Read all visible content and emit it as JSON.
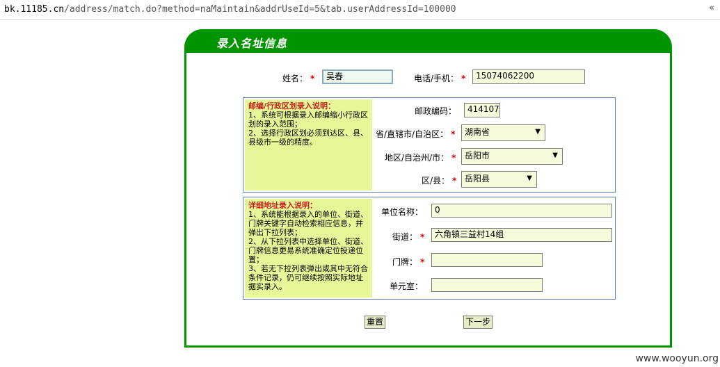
{
  "browser": {
    "url_host": "bk.11185.cn",
    "url_path": "/address/match.do?method=naMaintain&addrUseId=5&tab.userAddressId=100000",
    "menu_chevron": "«"
  },
  "panel": {
    "title": "录入名址信息"
  },
  "required_mark": "*",
  "name": {
    "label": "姓名：",
    "value": "吴春"
  },
  "phone": {
    "label": "电话/手机：",
    "value": "15074062200"
  },
  "region_note": {
    "title": "邮编/行政区划录入说明：",
    "lines": [
      "1、系统可根据录入邮编缩小行政区划的录入范围；",
      "2、选择行政区划必须到达区、县、县级市一级的精度。"
    ]
  },
  "postcode": {
    "label": "邮政编码：",
    "value": "414107"
  },
  "province": {
    "label": "省/直辖市/自治区：",
    "value": "湖南省"
  },
  "city": {
    "label": "地区/自治州/市：",
    "value": "岳阳市"
  },
  "district": {
    "label": "区/县：",
    "value": "岳阳县"
  },
  "detail_note": {
    "title": "详细地址录入说明：",
    "lines": [
      "1、系统能根据录入的单位、街道、门牌关键字自动检索相应信息，并弹出下拉列表；",
      "2、从下拉列表中选择单位、街道、门牌信息更易系统准确定位投递位置；",
      "3、若无下拉列表弹出或其中无符合条件记录，仍可继续按照实际地址据实录入。"
    ]
  },
  "unit": {
    "label": "单位名称：",
    "value": "0"
  },
  "street": {
    "label": "街道：",
    "value": "六角镇三益村14组"
  },
  "door": {
    "label": "门牌：",
    "value": ""
  },
  "room": {
    "label": "单元室：",
    "value": ""
  },
  "buttons": {
    "reset": "重置",
    "next": "下一步"
  },
  "watermark": "www.wooyun.org"
}
